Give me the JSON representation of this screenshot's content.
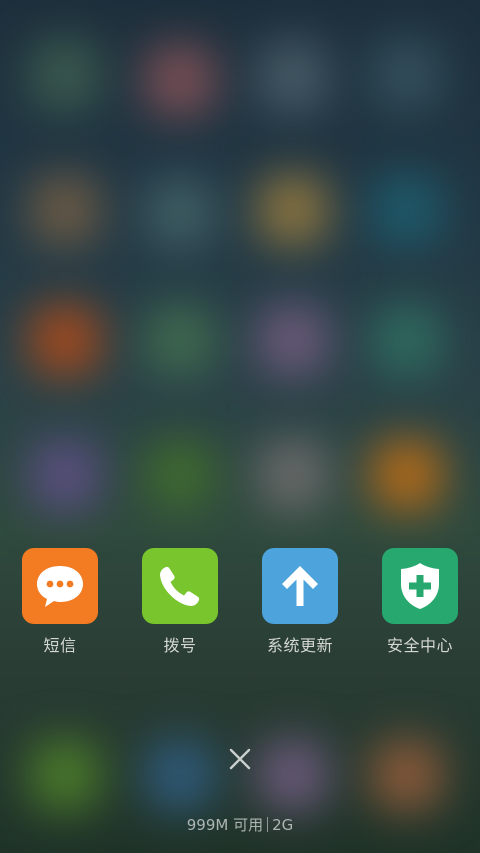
{
  "recents_tray": {
    "apps": [
      {
        "label": "短信",
        "icon": "message-bubble-icon",
        "color": "#f37c23"
      },
      {
        "label": "拨号",
        "icon": "phone-icon",
        "color": "#79c52d"
      },
      {
        "label": "系统更新",
        "icon": "up-arrow-icon",
        "color": "#4da4dc"
      },
      {
        "label": "安全中心",
        "icon": "shield-plus-icon",
        "color": "#27a86f"
      }
    ]
  },
  "close_icon": "close-icon",
  "memory": {
    "available": "999M 可用",
    "total": "2G"
  }
}
